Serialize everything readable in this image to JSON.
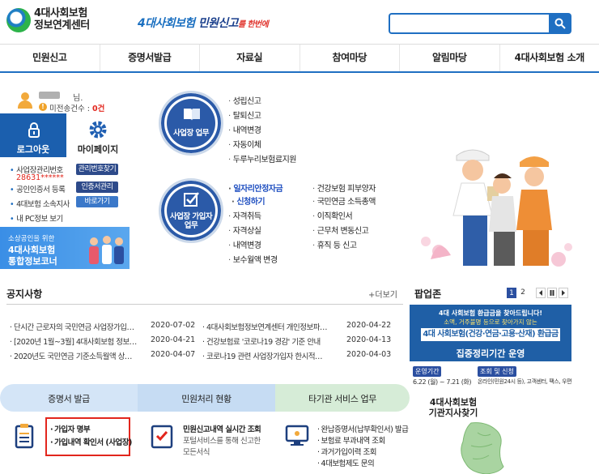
{
  "header": {
    "logo_line1": "4대사회보험",
    "logo_line2": "정보연계센터",
    "slogan_part1": "4대사회보험",
    "slogan_part2": "민원신고",
    "slogan_part3": "를 한번에"
  },
  "nav": [
    "민원신고",
    "증명서발급",
    "자료실",
    "참여마당",
    "알림마당",
    "4대사회보험 소개"
  ],
  "login": {
    "user_name_suffix": "님.",
    "pending_label": "미전송건수 : ",
    "pending_count": "0건",
    "logout_label": "로그아웃",
    "mypage_label": "마이페이지",
    "rows": [
      {
        "label": "사업장관리번호",
        "button": "관리번호찾기"
      },
      {
        "label": "공인인증서 등록",
        "button": "인증서관리"
      },
      {
        "label": "4대보험 소속지사",
        "button": "바로가기"
      },
      {
        "label": "내 PC정보 보기",
        "button": ""
      }
    ],
    "biz_number": "28631******",
    "banner_line1": "소상공인을 위한",
    "banner_line2": "4대사회보험",
    "banner_line3": "통합정보코너"
  },
  "biz_work": {
    "label_line1": "사업장 업무",
    "items": [
      "성립신고",
      "탈퇴신고",
      "내역변경",
      "자동이체",
      "두루누리보험료지원"
    ]
  },
  "member_work": {
    "label_line1": "사업장 가입자",
    "label_line2": "업무",
    "col1": [
      "일자리안정자금",
      "신청하기",
      "자격취득",
      "자격상실",
      "내역변경",
      "보수월액 변경"
    ],
    "col2": [
      "건강보험 피부양자",
      "국민연금 소득총액",
      "이직확인서",
      "근무처 변동신고",
      "휴직 등 신고"
    ]
  },
  "notice": {
    "title": "공지사항",
    "more": "+더보기",
    "items": [
      {
        "title": "단시간 근로자의 국민연금 사업장가입…",
        "date": "2020-07-02"
      },
      {
        "title": "4대사회보험정보연계센터 개인정보파…",
        "date": "2020-04-22"
      },
      {
        "title": "[2020년 1월~3월] 4대사회보험 정보…",
        "date": "2020-04-21"
      },
      {
        "title": "건강보험료 '코로나19 경감' 기준 안내",
        "date": "2020-04-13"
      },
      {
        "title": "2020년도 국민연금 기준소득월액 상…",
        "date": "2020-04-07"
      },
      {
        "title": "코로나19 관련 사업장가입자 한시적…",
        "date": "2020-04-03"
      }
    ]
  },
  "popup": {
    "title": "팝업존",
    "pages": [
      "1",
      "2"
    ],
    "banner_line1": "4대 사회보험 환급금을 찾아드립니다!",
    "banner_line2": "소액, 거주불명 등으로 찾아가지 않는",
    "banner_line3": "4대 사회보험(건강·연금·고용·산재) 환급금",
    "banner_line4": "집중정리기간 운영",
    "tag1": "운영기간",
    "tag1_text": "6.22 (월) ~ 7.21 (화)",
    "tag2": "조회 및 신청",
    "tag2_text": "온라인(민원24시 등), 고객센터, 팩스, 우편"
  },
  "tabs": {
    "cert": "증명서 발급",
    "civil": "민원처리 현황",
    "other": "타기관 서비스 업무"
  },
  "cert_items": [
    "가입자 명부",
    "가입내역 확인서 (사업장)"
  ],
  "civil_items": [
    "민원신고내역 실시간 조회",
    "포털서비스를 통해 신고한",
    "모든서식"
  ],
  "other_items": [
    "완납증명서(납부확인서) 발급",
    "보험료 부과내역 조회",
    "과거가입이력 조회",
    "4대보험제도 문의"
  ],
  "finder": {
    "line1": "4대사회보험",
    "line2": "기관지사찾기"
  }
}
